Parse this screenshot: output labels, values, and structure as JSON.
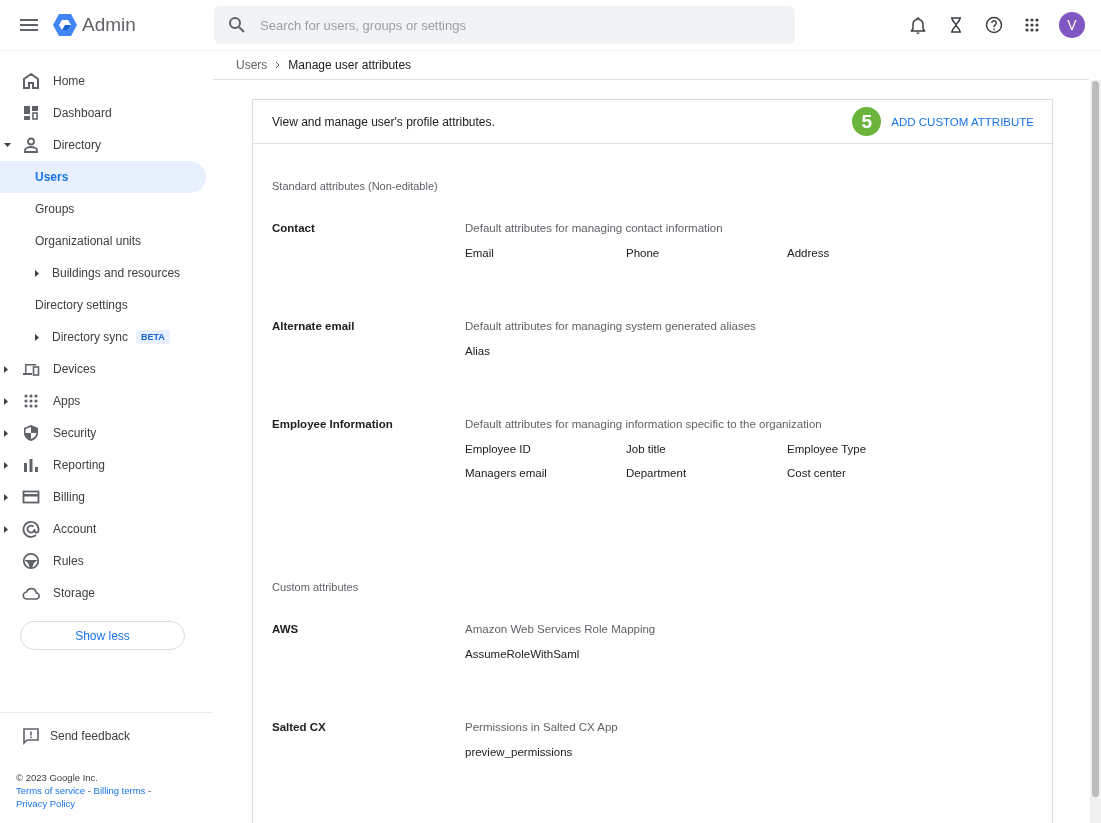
{
  "header": {
    "product": "Admin",
    "search": {
      "placeholder": "Search for users, groups or settings"
    },
    "avatar": "V"
  },
  "sidebar": {
    "items": [
      {
        "label": "Home",
        "kind": "link",
        "selected": false
      },
      {
        "label": "Dashboard",
        "kind": "link",
        "selected": false
      },
      {
        "label": "Directory",
        "kind": "group",
        "expanded": true,
        "selected": false,
        "children": [
          {
            "label": "Users",
            "kind": "link",
            "selected": true
          },
          {
            "label": "Groups",
            "kind": "link",
            "selected": false
          },
          {
            "label": "Organizational units",
            "kind": "link",
            "selected": false
          },
          {
            "label": "Buildings and resources",
            "kind": "group",
            "expanded": false,
            "selected": false
          },
          {
            "label": "Directory settings",
            "kind": "link",
            "selected": false
          },
          {
            "label": "Directory sync",
            "kind": "group",
            "expanded": false,
            "selected": false,
            "badge": "BETA"
          }
        ]
      },
      {
        "label": "Devices",
        "kind": "group",
        "expanded": false,
        "selected": false
      },
      {
        "label": "Apps",
        "kind": "group",
        "expanded": false,
        "selected": false
      },
      {
        "label": "Security",
        "kind": "group",
        "expanded": false,
        "selected": false
      },
      {
        "label": "Reporting",
        "kind": "group",
        "expanded": false,
        "selected": false
      },
      {
        "label": "Billing",
        "kind": "group",
        "expanded": false,
        "selected": false
      },
      {
        "label": "Account",
        "kind": "group",
        "expanded": false,
        "selected": false
      },
      {
        "label": "Rules",
        "kind": "link",
        "selected": false
      },
      {
        "label": "Storage",
        "kind": "link",
        "selected": false
      }
    ],
    "show_less": "Show less",
    "feedback": "Send feedback",
    "copyright": "© 2023 Google Inc.",
    "links": [
      "Terms of service",
      "Billing terms",
      "Privacy Policy"
    ],
    "link_separator": "-"
  },
  "breadcrumb": [
    "Users",
    "Manage user attributes"
  ],
  "card": {
    "description": "View and manage user's profile attributes.",
    "step": "5",
    "action": "ADD CUSTOM ATTRIBUTE",
    "sections": [
      {
        "heading": "Standard attributes (Non-editable)",
        "groups": [
          {
            "name": "Contact",
            "description": "Default attributes for managing contact information",
            "fields": [
              "Email",
              "Phone",
              "Address"
            ]
          },
          {
            "name": "Alternate email",
            "description": "Default attributes for managing system generated aliases",
            "fields": [
              "Alias"
            ]
          },
          {
            "name": "Employee Information",
            "description": "Default attributes for managing information specific to the organization",
            "fields": [
              "Employee ID",
              "Job title",
              "Employee Type",
              "Managers email",
              "Department",
              "Cost center"
            ]
          }
        ]
      },
      {
        "heading": "Custom attributes",
        "groups": [
          {
            "name": "AWS",
            "description": "Amazon Web Services Role Mapping",
            "fields": [
              "AssumeRoleWithSaml"
            ]
          },
          {
            "name": "Salted CX",
            "description": "Permissions in Salted CX App",
            "fields": [
              "preview_permissions"
            ]
          }
        ]
      }
    ]
  }
}
